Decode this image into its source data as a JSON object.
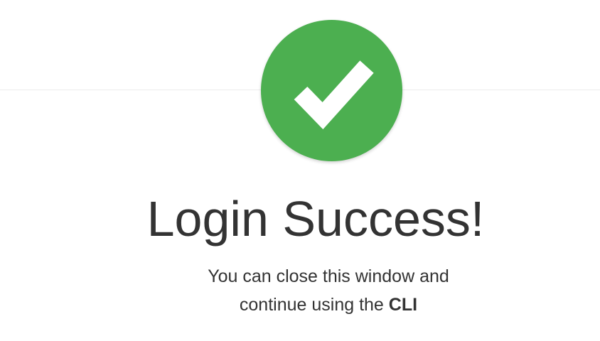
{
  "status": {
    "icon": "checkmark-circle-icon",
    "accent_color": "#4caf50"
  },
  "title": "Login Success!",
  "message": {
    "line1": "You can close this window and",
    "line2_prefix": "continue using the ",
    "line2_strong": "CLI"
  }
}
